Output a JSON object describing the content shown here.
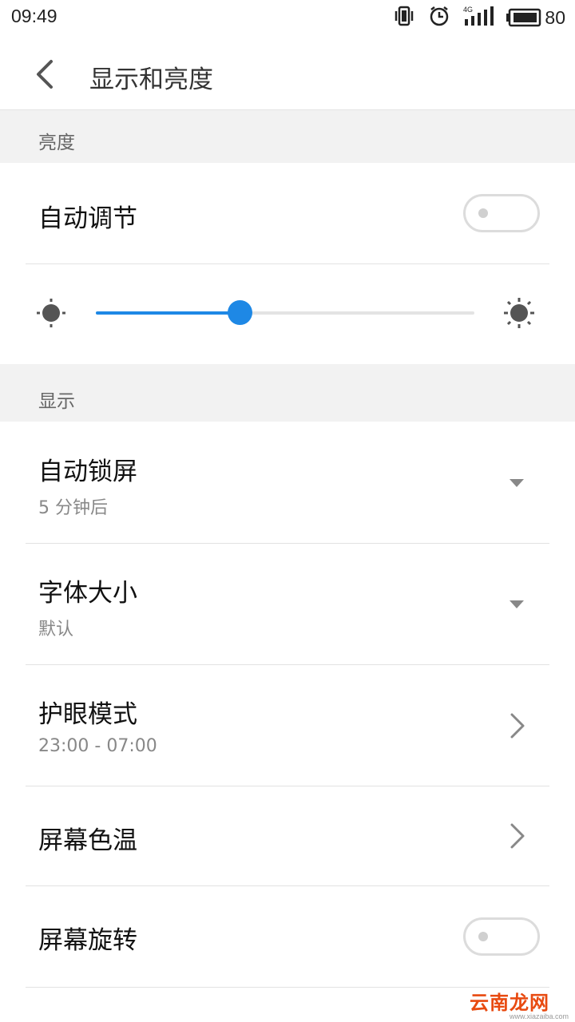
{
  "status_bar": {
    "time": "09:49",
    "network": "4G",
    "battery": "80",
    "icons": [
      "vibrate-icon",
      "alarm-icon",
      "signal-4g-icon",
      "battery-icon"
    ]
  },
  "header": {
    "back_icon": "back-arrow-icon",
    "title": "显示和亮度"
  },
  "brightness_section": {
    "label": "亮度",
    "auto_adjust": {
      "label": "自动调节",
      "enabled": false
    },
    "slider": {
      "value": 0.38,
      "low_icon": "brightness-low-icon",
      "high_icon": "brightness-high-icon"
    }
  },
  "display_section": {
    "label": "显示",
    "items": [
      {
        "title": "自动锁屏",
        "subtitle": "5 分钟后",
        "control": "dropdown"
      },
      {
        "title": "字体大小",
        "subtitle": "默认",
        "control": "dropdown"
      },
      {
        "title": "护眼模式",
        "subtitle": "23:00 - 07:00",
        "control": "chevron"
      },
      {
        "title": "屏幕色温",
        "subtitle": "",
        "control": "chevron"
      },
      {
        "title": "屏幕旋转",
        "subtitle": "",
        "control": "toggle",
        "enabled": false
      }
    ]
  },
  "watermark": {
    "text": "云南龙网",
    "url_text": "www.xiazaiba.com"
  },
  "colors": {
    "accent": "#1e88e5",
    "section_bg": "#f2f2f2",
    "watermark": "#e84a10"
  }
}
